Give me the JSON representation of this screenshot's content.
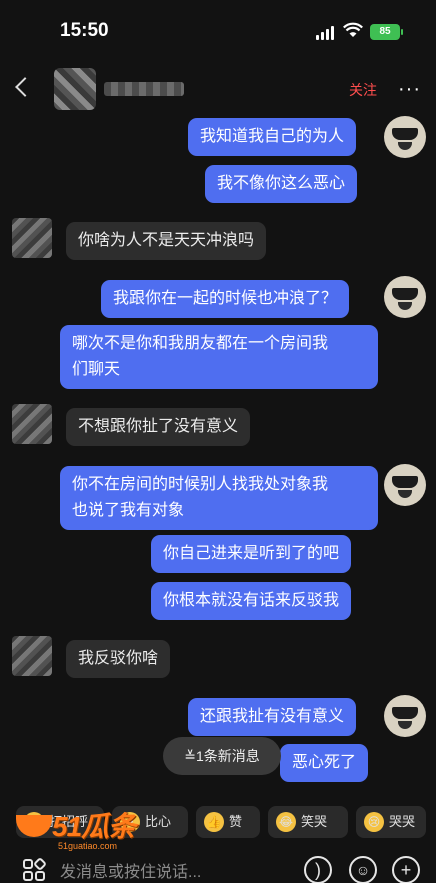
{
  "status": {
    "time": "15:50",
    "battery": "85"
  },
  "header": {
    "follow_label": "关注",
    "more": "···"
  },
  "messages": [
    {
      "side": "me",
      "text": "我知道我自己的为人"
    },
    {
      "side": "me",
      "text": "我不像你这么恶心"
    },
    {
      "side": "them",
      "text": "你啥为人不是天天冲浪吗"
    },
    {
      "side": "me",
      "text": "我跟你在一起的时候也冲浪了？"
    },
    {
      "side": "me",
      "line1": "哪次不是你和我朋友都在一个房间我",
      "line2": "们聊天"
    },
    {
      "side": "them",
      "text": "不想跟你扯了没有意义"
    },
    {
      "side": "me",
      "line1": "你不在房间的时候别人找我处对象我",
      "line2": "也说了我有对象"
    },
    {
      "side": "me",
      "text": "你自己进来是听到了的吧"
    },
    {
      "side": "me",
      "text": "你根本就没有话来反驳我"
    },
    {
      "side": "them",
      "text": "我反驳你啥"
    },
    {
      "side": "me",
      "text": "还跟我扯有没有意义"
    },
    {
      "side": "me",
      "text": "恶心死了"
    }
  ],
  "new_messages": "≚1条新消息",
  "quick_replies": [
    {
      "label": "打招呼",
      "icon": "wave-emoji"
    },
    {
      "label": "比心",
      "icon": "heart-hands-emoji"
    },
    {
      "label": "赞",
      "icon": "thumbs-up-emoji"
    },
    {
      "label": "笑哭",
      "icon": "laugh-cry-emoji"
    },
    {
      "label": "哭哭",
      "icon": "crying-emoji"
    }
  ],
  "watermark": {
    "brand": "51瓜条",
    "url": "51guatiao.com"
  },
  "input": {
    "placeholder": "发消息或按住说话..."
  },
  "colors": {
    "my_bubble": "#4f6ef0",
    "their_bubble": "#2d2d2d",
    "follow": "#ff4e4e",
    "battery": "#3fbf53"
  }
}
